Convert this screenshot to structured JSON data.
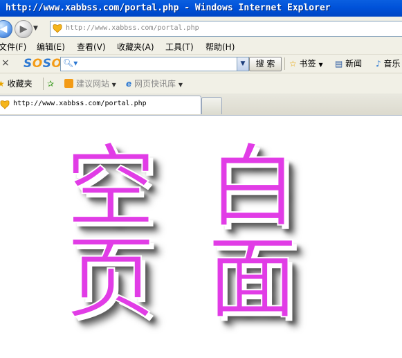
{
  "window": {
    "title": "http://www.xabbss.com/portal.php - Windows Internet Explorer"
  },
  "address": {
    "url": "http://www.xabbss.com/portal.php"
  },
  "menu": [
    {
      "label": "文件(F)"
    },
    {
      "label": "编辑(E)"
    },
    {
      "label": "查看(V)"
    },
    {
      "label": "收藏夹(A)"
    },
    {
      "label": "工具(T)"
    },
    {
      "label": "帮助(H)"
    }
  ],
  "soso": {
    "logo": [
      "S",
      "O",
      "S",
      "O"
    ],
    "search_label": "搜 索",
    "bookmarks": "书签",
    "news": "新闻",
    "music": "音乐"
  },
  "favorites": {
    "label": "收藏夹",
    "suggested": "建议网站",
    "slices": "网页快讯库"
  },
  "tab": {
    "title": "http://www.xabbss.com/portal.php"
  },
  "content": {
    "line1": [
      "空",
      "白"
    ],
    "line2": [
      "页",
      "面"
    ]
  },
  "colors": {
    "title_bar": "#0052d9",
    "chrome": "#f1f0e6",
    "glyph": "#e13ce6"
  }
}
